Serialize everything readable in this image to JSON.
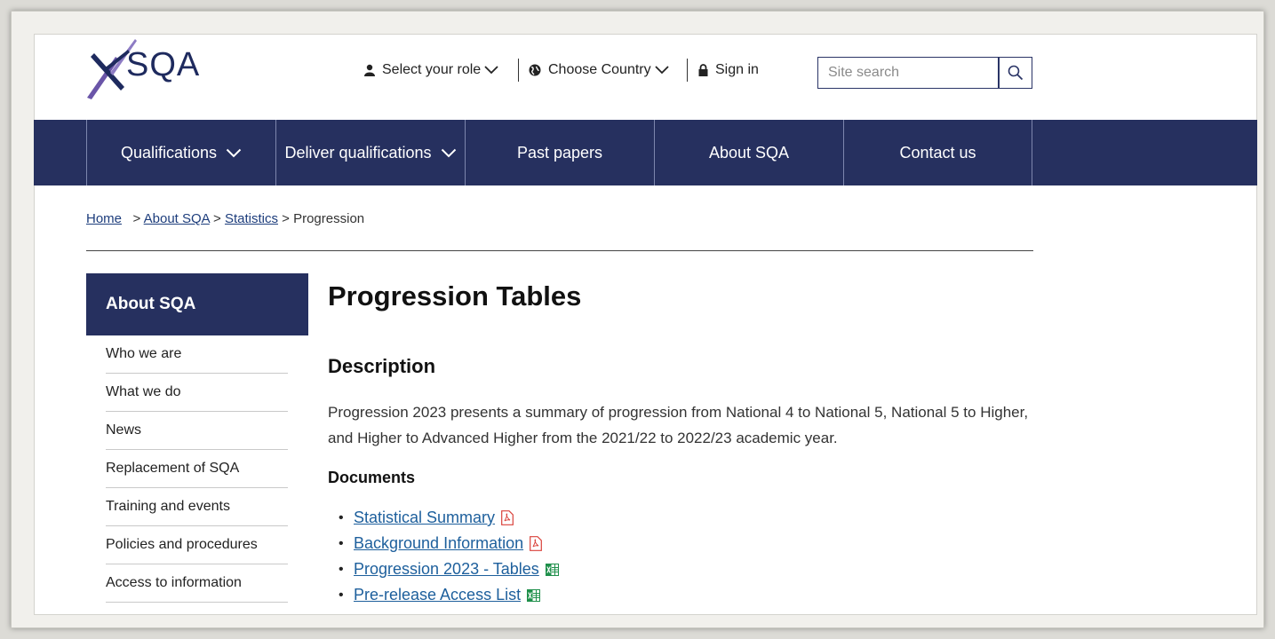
{
  "header": {
    "logo_text": "SQA",
    "select_role": "Select your role",
    "choose_country": "Choose Country",
    "sign_in": "Sign in",
    "search_placeholder": "Site search"
  },
  "nav": {
    "items": [
      {
        "label": "Qualifications",
        "has_dropdown": true
      },
      {
        "label": "Deliver qualifications",
        "has_dropdown": true
      },
      {
        "label": "Past papers",
        "has_dropdown": false
      },
      {
        "label": "About SQA",
        "has_dropdown": false
      },
      {
        "label": "Contact us",
        "has_dropdown": false
      }
    ]
  },
  "breadcrumb": {
    "home": "Home",
    "about": "About SQA",
    "statistics": "Statistics",
    "current": "Progression",
    "sep": ">"
  },
  "sidebar": {
    "heading": "About SQA",
    "items": [
      "Who we are",
      "What we do",
      "News",
      "Replacement of SQA",
      "Training and events",
      "Policies and procedures",
      "Access to information"
    ]
  },
  "main": {
    "title": "Progression Tables",
    "description_heading": "Description",
    "description": "Progression 2023 presents a summary of progression from National 4 to National 5, National 5 to Higher, and Higher to Advanced Higher from the 2021/22 to 2022/23 academic year.",
    "documents_heading": "Documents",
    "documents": [
      {
        "label": "Statistical Summary",
        "file_type": "pdf"
      },
      {
        "label": "Background Information",
        "file_type": "pdf"
      },
      {
        "label": "Progression 2023 - Tables",
        "file_type": "excel"
      },
      {
        "label": "Pre-release Access List",
        "file_type": "excel"
      }
    ]
  },
  "colors": {
    "nav_bg": "#26305f",
    "link": "#1d5f9c",
    "pdf_icon": "#d9413a",
    "excel_icon": "#1e8f4a"
  }
}
